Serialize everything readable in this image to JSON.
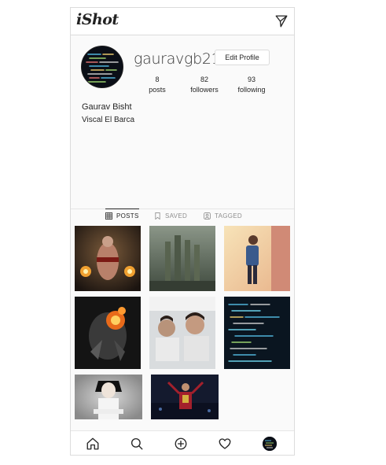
{
  "app": {
    "brand": "iShot"
  },
  "profile": {
    "username": "gauravgb21",
    "edit_label": "Edit Profile",
    "stats": {
      "posts": {
        "value": "8",
        "label": "posts"
      },
      "followers": {
        "value": "82",
        "label": "followers"
      },
      "following": {
        "value": "93",
        "label": "following"
      }
    },
    "full_name": "Gaurav Bisht",
    "bio": "Viscal El Barca"
  },
  "tabs": [
    {
      "label": "POSTS",
      "icon": "grid-icon",
      "active": true
    },
    {
      "label": "SAVED",
      "icon": "bookmark-icon",
      "active": false
    },
    {
      "label": "TAGGED",
      "icon": "tag-user-icon",
      "active": false
    }
  ],
  "icons": {
    "top_right": "paper-plane-icon",
    "nav": [
      "home-icon",
      "search-icon",
      "add-icon",
      "heart-icon",
      "profile-avatar"
    ]
  },
  "colors": {
    "background": "#fafafa",
    "text": "#262626",
    "muted": "#8e8e8e",
    "border": "#dbdbdb"
  }
}
